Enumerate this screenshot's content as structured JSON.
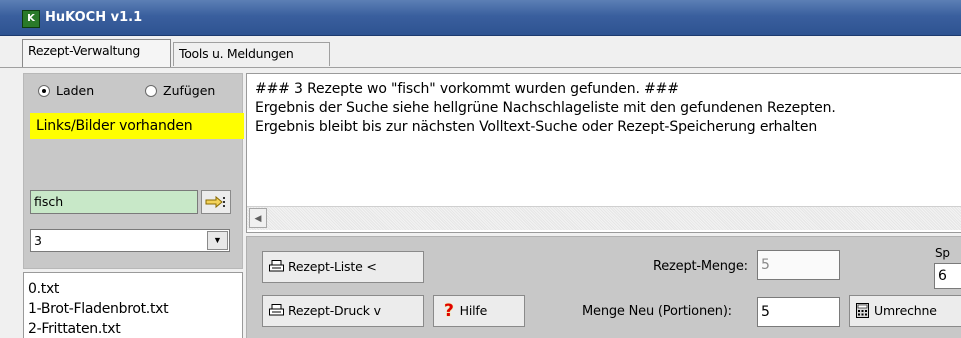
{
  "window": {
    "title": "HuKOCH v1.1",
    "icon": "app-logo"
  },
  "tabs": [
    {
      "label": "Rezept-Verwaltung"
    },
    {
      "label": "Tools u. Meldungen"
    }
  ],
  "left": {
    "radio_load": "Laden",
    "radio_add": "Zufügen",
    "banner": "Links/Bilder vorhanden",
    "banner_color": "#ffff00",
    "search_value": "fisch",
    "search_color": "#c8e8c8",
    "count_value": "3",
    "files": [
      "0.txt",
      "1-Brot-Fladenbrot.txt",
      "2-Frittaten.txt"
    ]
  },
  "message": {
    "lines": [
      "### 3 Rezepte wo \"fisch\" vorkommt wurden gefunden. ###",
      "Ergebnis der Suche siehe hellgrüne Nachschlageliste mit den gefundenen Rezepten.",
      "Ergebnis bleibt bis zur nächsten Volltext-Suche oder Rezept-Speicherung erhalten"
    ]
  },
  "controls": {
    "rezept_liste_label": "Rezept-Liste  <",
    "rezept_druck_label": "Rezept-Druck  v",
    "hilfe_label": "Hilfe",
    "rezept_menge_label": "Rezept-Menge:",
    "rezept_menge_value": "5",
    "menge_neu_label": "Menge Neu (Portionen):",
    "menge_neu_value": "5",
    "umrechnen_label": "Umrechne",
    "cut_label_top": "Sp",
    "cut_field_value": "6"
  }
}
